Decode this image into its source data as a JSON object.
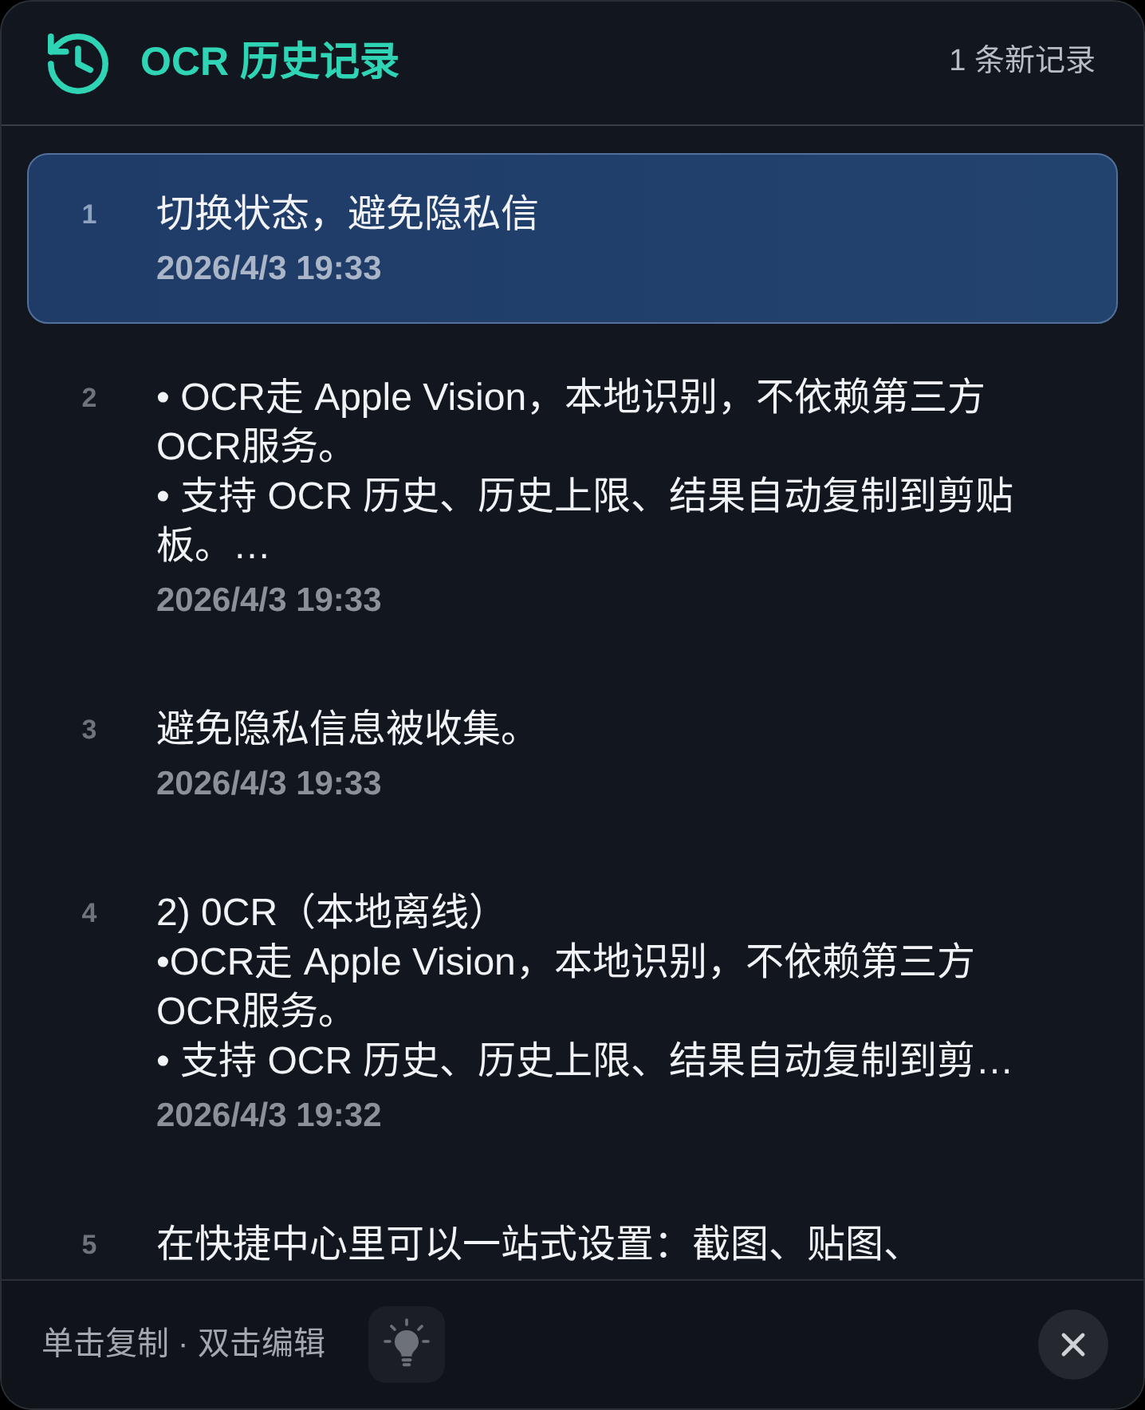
{
  "header": {
    "title": "OCR 历史记录",
    "new_count": "1 条新记录"
  },
  "items": [
    {
      "number": "1",
      "text": "切换状态，避免隐私信",
      "time": "2026/4/3 19:33",
      "selected": true
    },
    {
      "number": "2",
      "text": "• OCR走 Apple Vision，本地识别，不依赖第三方OCR服务。\n• 支持 OCR 历史、历史上限、结果自动复制到剪贴板。…",
      "time": "2026/4/3 19:33",
      "selected": false
    },
    {
      "number": "3",
      "text": "避免隐私信息被收集。",
      "time": "2026/4/3 19:33",
      "selected": false
    },
    {
      "number": "4",
      "text": "2) 0CR（本地离线）\n•OCR走 Apple Vision，本地识别，不依赖第三方OCR服务。\n• 支持 OCR 历史、历史上限、结果自动复制到剪…",
      "time": "2026/4/3 19:32",
      "selected": false
    },
    {
      "number": "5",
      "text": "在快捷中心里可以一站式设置：截图、贴图、",
      "selected": false
    }
  ],
  "footer": {
    "hint": "单击复制 · 双击编辑"
  }
}
